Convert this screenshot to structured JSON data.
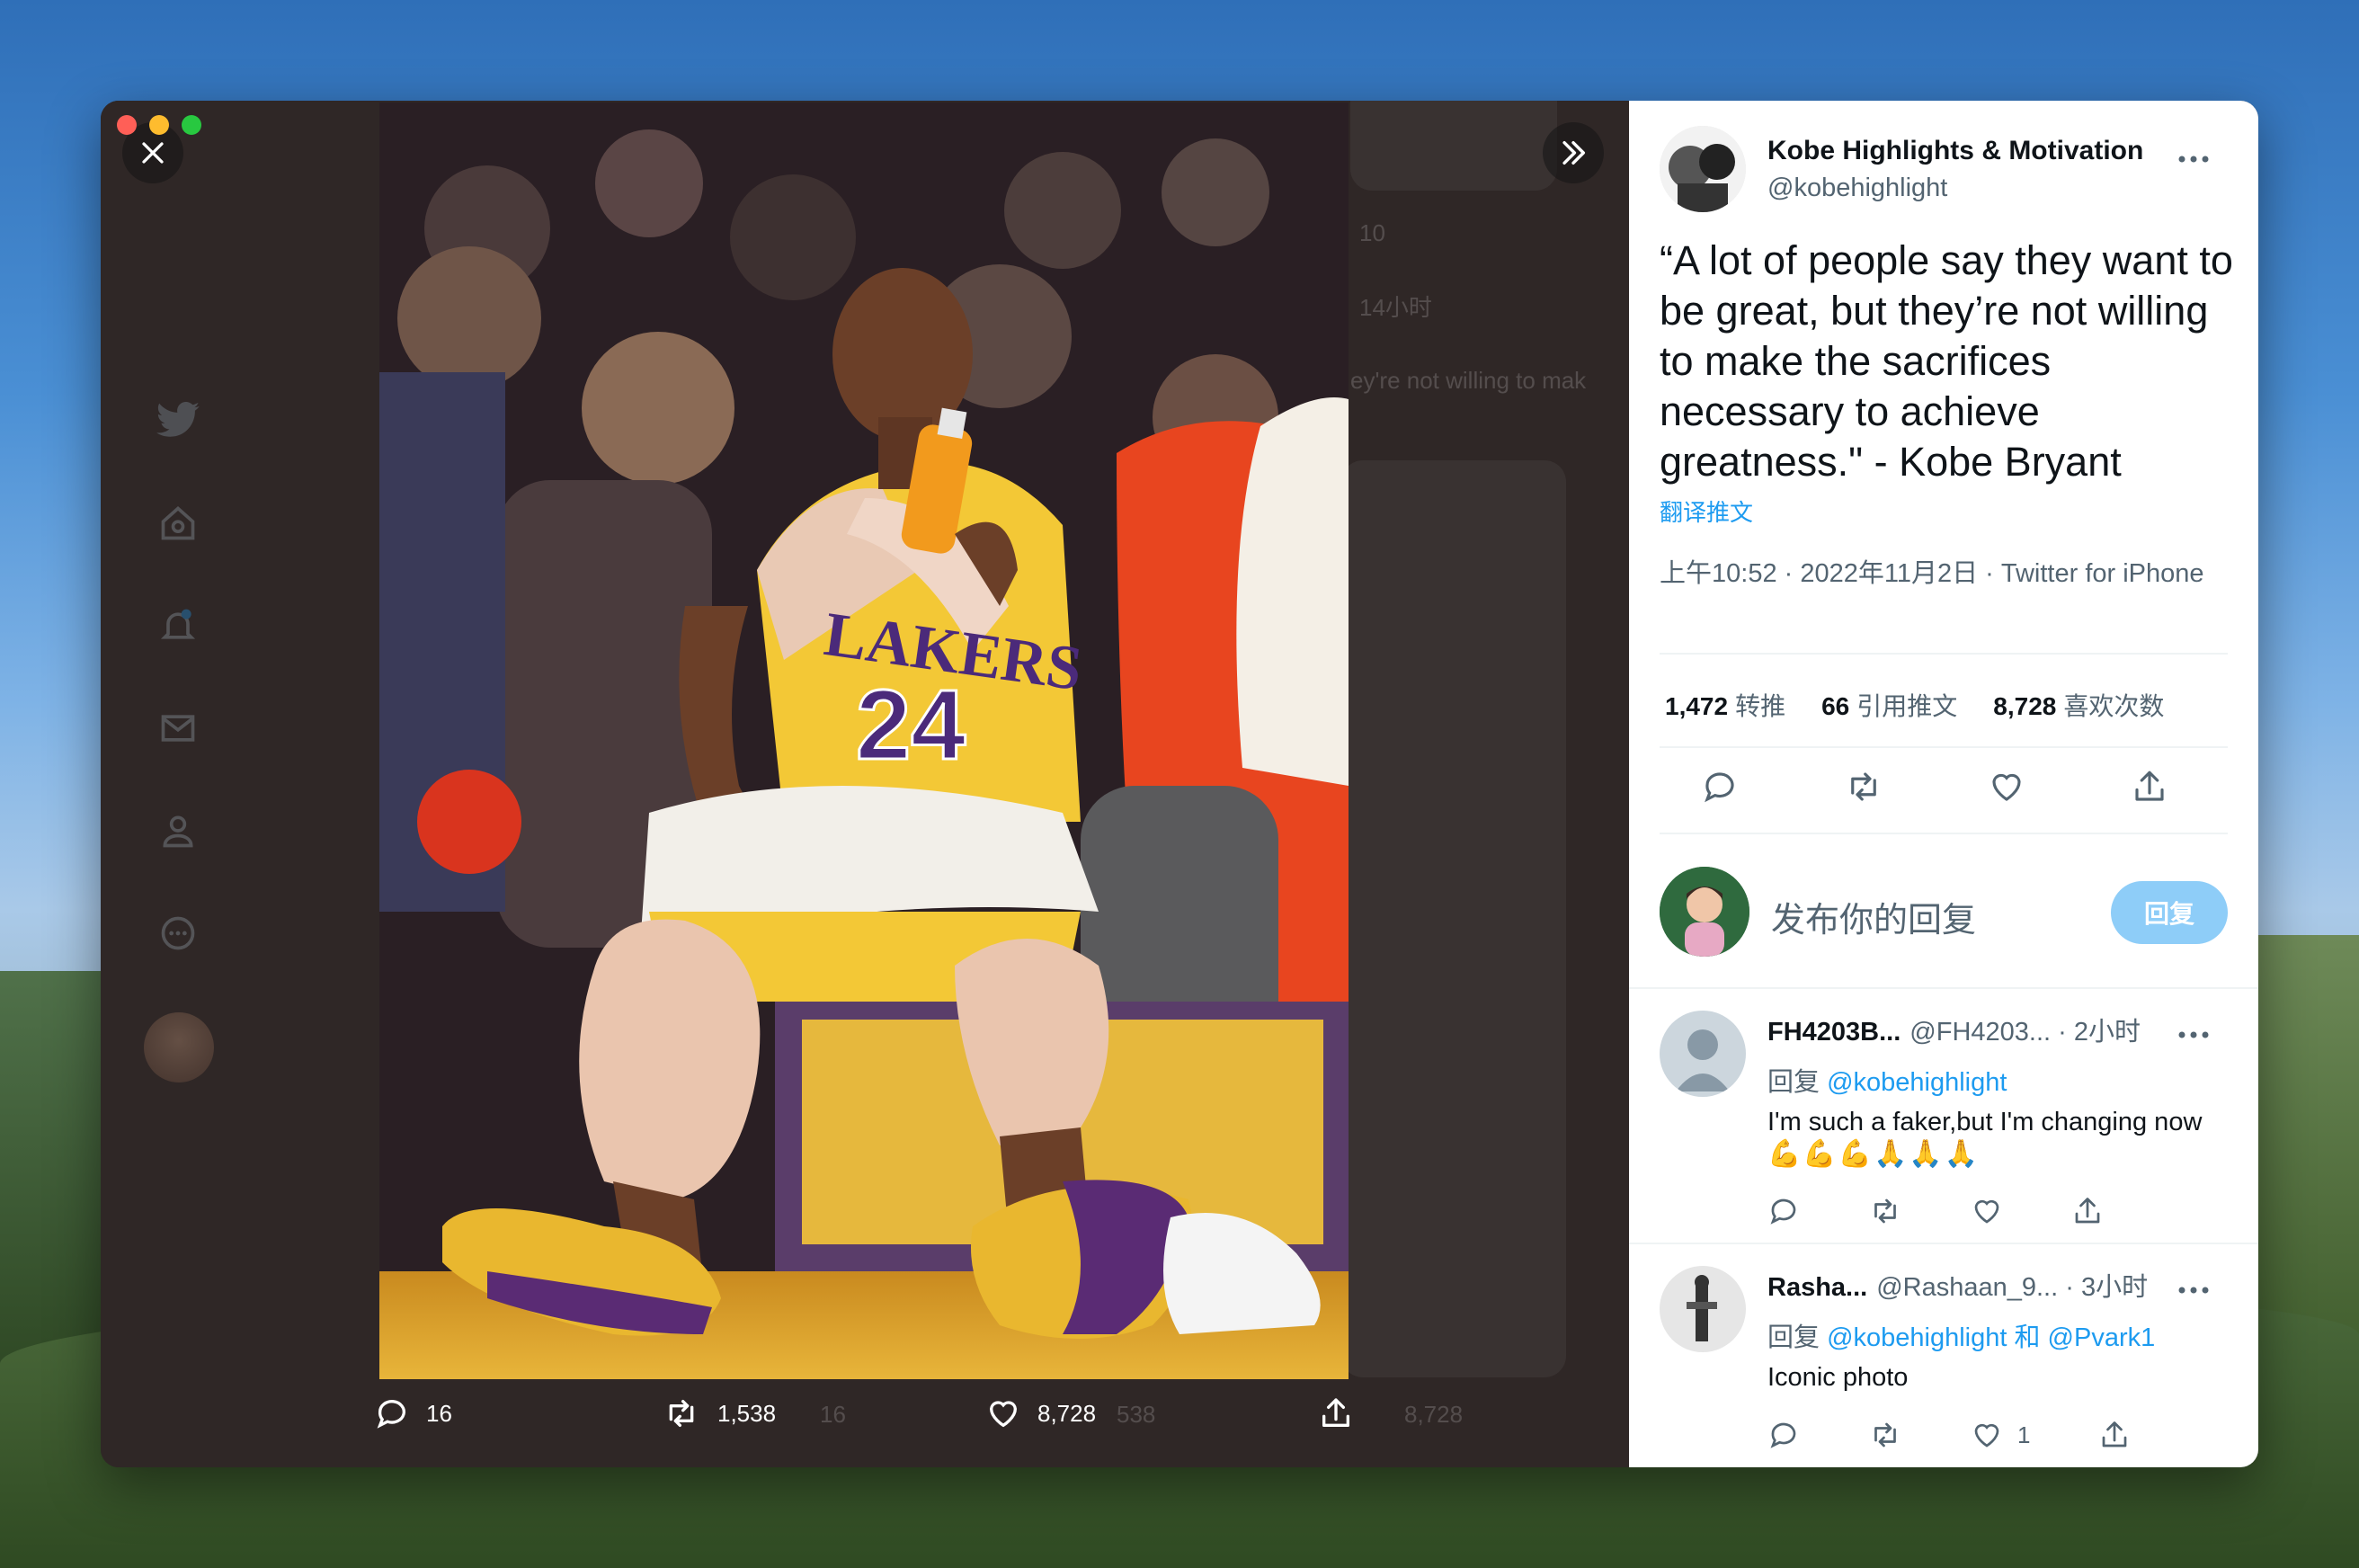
{
  "window": {
    "close_label": "×",
    "expand_label": "»"
  },
  "media": {
    "ghost_count_top": "10",
    "ghost_time": "14小时",
    "ghost_text": "ey're not willing to mak",
    "ghost_reply": "16",
    "ghost_retweet": "538",
    "ghost_like": "8,728",
    "actions": {
      "reply_count": "16",
      "retweet_count": "1,538",
      "like_count": "8,728"
    }
  },
  "tweet": {
    "author_name": "Kobe Highlights & Motivation",
    "author_handle": "@kobehighlight",
    "text": "“A lot of people say they want to be great, but they’re not willing to make the sacrifices necessary to achieve greatness.\" - Kobe Bryant",
    "translate_label": "翻译推文",
    "meta": "上午10:52 · 2022年11月2日 · Twitter for iPhone",
    "stats": {
      "retweets_value": "1,472",
      "retweets_label": "转推",
      "quotes_value": "66",
      "quotes_label": "引用推文",
      "likes_value": "8,728",
      "likes_label": "喜欢次数"
    }
  },
  "compose": {
    "placeholder": "发布你的回复",
    "button_label": "回复"
  },
  "replies": [
    {
      "name": "FH4203B...",
      "handle": "@FH4203...",
      "time": "· 2小时",
      "to_prefix": "回复",
      "to_mentions": "@kobehighlight",
      "text": "I'm such a faker,but I'm changing now",
      "emoji": "💪💪💪🙏🙏🙏",
      "like_count": ""
    },
    {
      "name": "Rasha...",
      "handle": "@Rashaan_9...",
      "time": "· 3小时",
      "to_prefix": "回复",
      "to_mentions": "@kobehighlight 和 @Pvark1",
      "text": "Iconic photo",
      "emoji": "",
      "like_count": "1"
    }
  ],
  "colors": {
    "accent": "#1d9bf0",
    "reply_button": "#8ecdf8",
    "media_bg": "#2f2726",
    "text_primary": "#0f1419",
    "text_secondary": "#536471"
  }
}
